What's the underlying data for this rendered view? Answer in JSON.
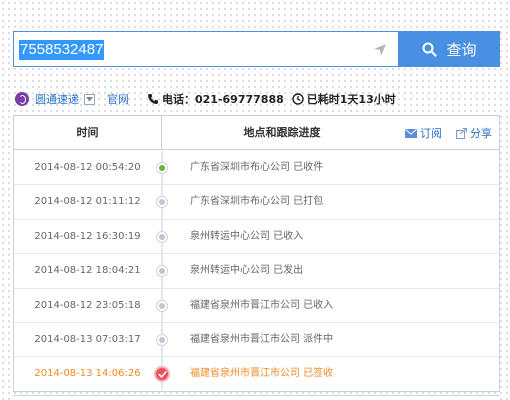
{
  "search": {
    "value": "7558532487",
    "button_label": "查询"
  },
  "info": {
    "courier_name": "圆通速递",
    "official_site": "官网",
    "phone": "电话：021-69777888",
    "elapsed": "已耗时1天13小时"
  },
  "table": {
    "header_time": "时间",
    "header_location": "地点和跟踪进度",
    "subscribe_label": "订阅",
    "share_label": "分享",
    "rows": [
      {
        "time": "2014-08-12 00:54:20",
        "desc": "广东省深圳市布心公司 已收件"
      },
      {
        "time": "2014-08-12 01:11:12",
        "desc": "广东省深圳市布心公司 已打包"
      },
      {
        "time": "2014-08-12 16:30:19",
        "desc": "泉州转运中心公司 已收入"
      },
      {
        "time": "2014-08-12 18:04:21",
        "desc": "泉州转运中心公司 已发出"
      },
      {
        "time": "2014-08-12 23:05:18",
        "desc": "福建省泉州市晋江市公司 已收入"
      },
      {
        "time": "2014-08-13 07:03:17",
        "desc": "福建省泉州市晋江市公司 派件中"
      },
      {
        "time": "2014-08-13 14:06:26",
        "desc": "福建省泉州市晋江市公司 已签收"
      }
    ]
  },
  "icons": {
    "search": "search-icon",
    "locate": "locate-arrow-icon",
    "phone": "phone-icon",
    "clock": "clock-icon",
    "mail": "mail-icon",
    "share": "share-icon",
    "status_start": "green-dot-icon",
    "status_signed": "check-circle-icon"
  },
  "colors": {
    "accent": "#4a90e2",
    "link": "#2a6fc9",
    "signed": "#f08a24",
    "start_dot": "#6ab534"
  }
}
